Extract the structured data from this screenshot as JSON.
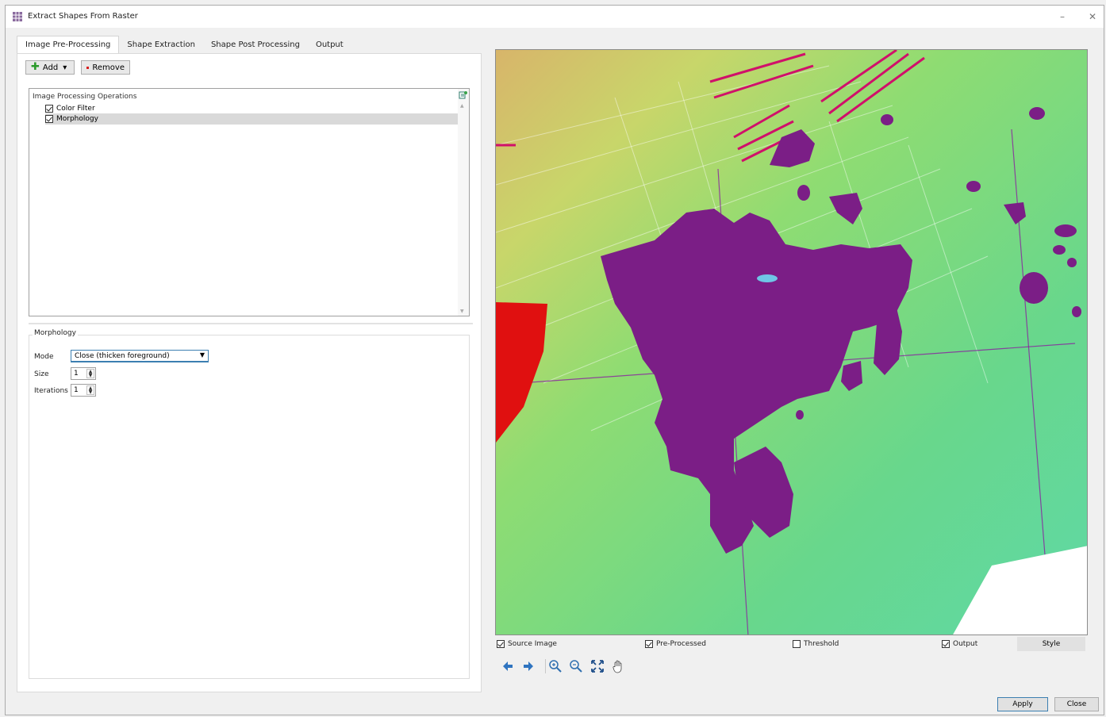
{
  "window": {
    "title": "Extract Shapes From Raster",
    "icon": "raster-tool-icon",
    "minimize": "–",
    "close": "✕"
  },
  "tabs": [
    {
      "label": "Image Pre-Processing",
      "active": true
    },
    {
      "label": "Shape Extraction",
      "active": false
    },
    {
      "label": "Shape Post Processing",
      "active": false
    },
    {
      "label": "Output",
      "active": false
    }
  ],
  "toolbar": {
    "add_label": "Add",
    "add_caret": "▾",
    "remove_label": "Remove"
  },
  "operations": {
    "header": "Image Processing Operations",
    "items": [
      {
        "label": "Color Filter",
        "checked": true,
        "selected": false
      },
      {
        "label": "Morphology",
        "checked": true,
        "selected": true
      }
    ]
  },
  "morphology": {
    "group_title": "Morphology",
    "mode_label": "Mode",
    "mode_value": "Close (thicken foreground)",
    "size_label": "Size",
    "size_value": "1",
    "iterations_label": "Iterations",
    "iterations_value": "1"
  },
  "view_options": {
    "source_image": {
      "label": "Source Image",
      "checked": true
    },
    "pre_processed": {
      "label": "Pre-Processed",
      "checked": true
    },
    "threshold": {
      "label": "Threshold",
      "checked": false
    },
    "output": {
      "label": "Output",
      "checked": true
    },
    "style_label": "Style"
  },
  "map_tools": [
    "back-icon",
    "forward-icon",
    "zoom-in-icon",
    "zoom-out-icon",
    "zoom-extent-icon",
    "pan-hand-icon"
  ],
  "buttons": {
    "apply": "Apply",
    "close": "Close"
  },
  "colors": {
    "accent": "#3c7fb1",
    "foreground_shape": "#7b1e86",
    "red_region": "#e01010",
    "raster_green": "#6fd58a",
    "raster_yellow": "#d9c46a"
  }
}
